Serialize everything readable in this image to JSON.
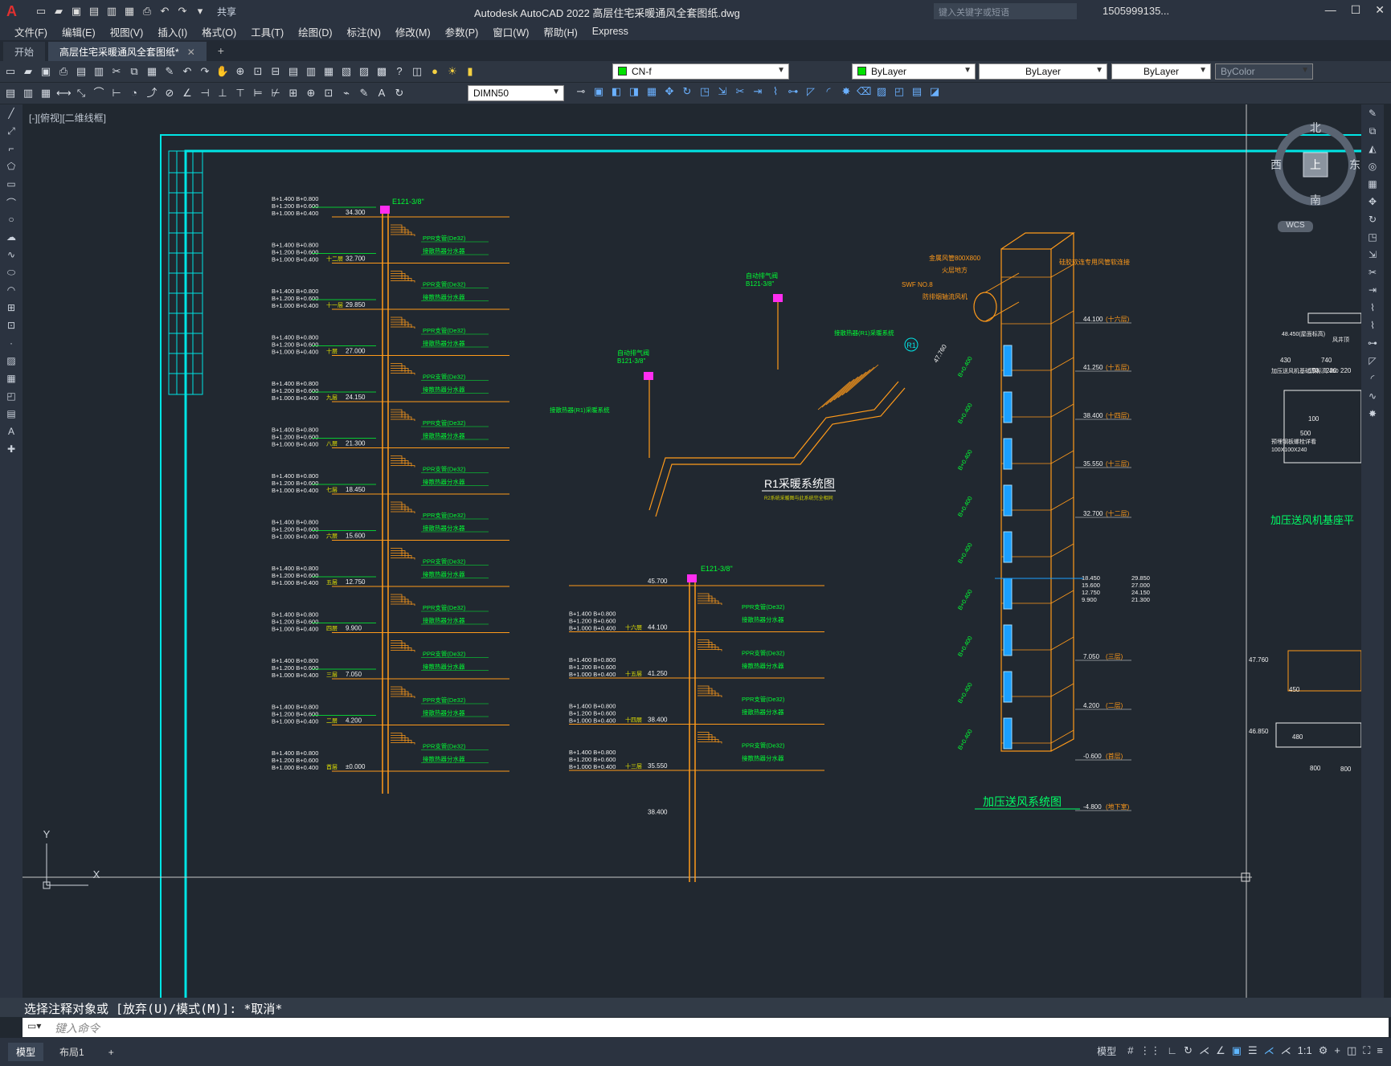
{
  "app": {
    "logo": "A",
    "title": "Autodesk AutoCAD 2022    高层住宅采暖通风全套图纸.dwg",
    "search_placeholder": "键入关键字或短语",
    "user": "1505999135...",
    "share": "共享"
  },
  "menu": [
    "文件(F)",
    "编辑(E)",
    "视图(V)",
    "插入(I)",
    "格式(O)",
    "工具(T)",
    "绘图(D)",
    "标注(N)",
    "修改(M)",
    "参数(P)",
    "窗口(W)",
    "帮助(H)",
    "Express"
  ],
  "tabs": {
    "start": "开始",
    "active": "高层住宅采暖通风全套图纸*",
    "close": "✕",
    "add": "+"
  },
  "layers": {
    "layer_name": "CN-f",
    "color": "ByLayer",
    "linetype": "ByLayer",
    "lineweight": "ByLayer",
    "plotstyle": "ByColor",
    "dimstyle": "DIMN50"
  },
  "canvas": {
    "view_label": "[-][俯视][二维线框]",
    "viewcube": {
      "north": "北",
      "south": "南",
      "east": "东",
      "west": "西",
      "top": "上",
      "wcs": "WCS"
    },
    "axis_y": "Y",
    "axis_x": "X"
  },
  "drawing": {
    "r1_title": "R1采暖系统图",
    "r1_subtitle": "R2系统采暖图与此系统完全相同",
    "fan_title": "加压送风系统图",
    "base_title": "加压送风机基座平",
    "pipe_top_left": "E121-3/8\"",
    "pipe_top_mid": "E121-3/8\"",
    "vent_label": "自动排气阀",
    "vent_code": "B121-3/8\"",
    "heat_note": "接散热器(R1)采暖系统",
    "riser_labels": [
      "34.300",
      "32.700",
      "29.850",
      "27.000",
      "24.150",
      "21.300",
      "18.450",
      "15.600",
      "12.750",
      "9.900",
      "7.050",
      "4.200",
      "±0.000"
    ],
    "floor_labels": [
      "十二层",
      "十一层",
      "十层",
      "九层",
      "八层",
      "七层",
      "六层",
      "五层",
      "四层",
      "三层",
      "二层",
      "首层"
    ],
    "mid_levels": [
      "45.700",
      "44.100",
      "41.250",
      "38.400",
      "35.550",
      "38.400"
    ],
    "mid_floors": [
      "十六层",
      "十五层",
      "十四层",
      "十三层"
    ],
    "ppr_label": "PPR支管(De32)",
    "manifold_label": "接散热器分水器",
    "elev_left": [
      "B+1.400 B+0.800",
      "B+1.200 B+0.600",
      "B+1.000 B+0.400"
    ],
    "fan_levels": [
      "44.100",
      "41.250",
      "38.400",
      "35.550",
      "32.700",
      "7.050",
      "4.200",
      "-0.600",
      "-4.800"
    ],
    "fan_floors": [
      "(十六层)",
      "(十五层)",
      "(十四层)",
      "(十三层)",
      "(十二层)",
      "(三层)",
      "(二层)",
      "(首层)",
      "(地下室)"
    ],
    "fan_mid_left": [
      "18.450",
      "15.600",
      "12.750",
      "9.900"
    ],
    "fan_mid_right": [
      "29.850",
      "27.000",
      "24.150",
      "21.300"
    ],
    "fan_tags": [
      "金属风管800X800",
      "火层地方",
      "SWF NO.8",
      "防排烟轴流风机",
      "硅胶软连专用风管软连接"
    ],
    "b_tag": "B+0.400",
    "elev_47": "47.760",
    "right_dims": [
      "430",
      "740",
      "150",
      "220",
      "220",
      "800",
      "500",
      "100",
      "47.760",
      "46.850",
      "450",
      "480",
      "800"
    ],
    "right_notes": [
      "48.450(屋面标高)",
      "风井顶",
      "加压送风机基础顶标高 460",
      "预埋钢板螺栓详看",
      "100X100X240"
    ]
  },
  "command": {
    "history": "选择注释对象或 [放弃(U)/模式(M)]: *取消*",
    "placeholder": "键入命令"
  },
  "status": {
    "model_tab": "模型",
    "layout_tab": "布局1",
    "add": "+",
    "model_label": "模型",
    "scale": "1:1"
  }
}
